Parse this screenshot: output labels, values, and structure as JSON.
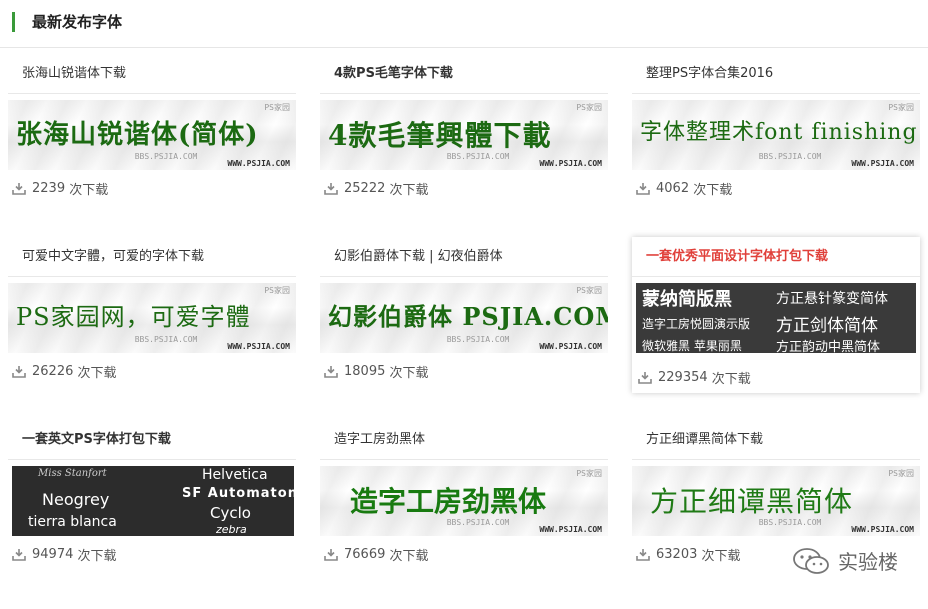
{
  "section": {
    "title": "最新发布字体"
  },
  "watermark": {
    "site": "PS家园",
    "sub": "BBS.PSJIA.COM",
    "url": "WWW.PSJIA.COM"
  },
  "download_suffix": "次下载",
  "cards": [
    {
      "title": "张海山锐谐体下载",
      "sample": "张海山锐谐体(简体)",
      "downloads": "2239"
    },
    {
      "title": "4款PS毛笔字体下载",
      "sample": "4款毛筆興體下載",
      "downloads": "25222"
    },
    {
      "title": "整理PS字体合集2016",
      "sample": "字体整理术font finishing",
      "downloads": "4062"
    },
    {
      "title": "可爱中文字體，可爱的字体下载",
      "sample": "PS家园网，可爱字體",
      "downloads": "26226"
    },
    {
      "title": "幻影伯爵体下载 | 幻夜伯爵体",
      "sample": "幻影伯爵体 PSJIA.COM",
      "downloads": "18095"
    },
    {
      "title": "一套优秀平面设计字体打包下载",
      "samples": [
        "蒙纳简版黑",
        "方正悬针篆变简体",
        "造字工房悦圆演示版",
        "方正剑体简体",
        "微软雅黑    苹果丽黑",
        "方正韵动中黑简体"
      ],
      "downloads": "229354"
    },
    {
      "title": "一套英文PS字体打包下载",
      "samples": [
        "Miss Stanfort",
        "Helvetica",
        "Neogrey",
        "SF Automaton",
        "tierra blanca",
        "Cyclo",
        "zebra"
      ],
      "downloads": "94974"
    },
    {
      "title": "造字工房劲黑体",
      "sample": "造字工房劲黑体",
      "downloads": "76669"
    },
    {
      "title": "方正细谭黑简体下载",
      "sample": "方正细谭黑简体",
      "downloads": "63203"
    }
  ],
  "footer": {
    "brand": "实验楼"
  },
  "colors": {
    "accent": "#3a9a3a",
    "sample_green": "#1c6a12",
    "highlight_red": "#e0403a"
  }
}
